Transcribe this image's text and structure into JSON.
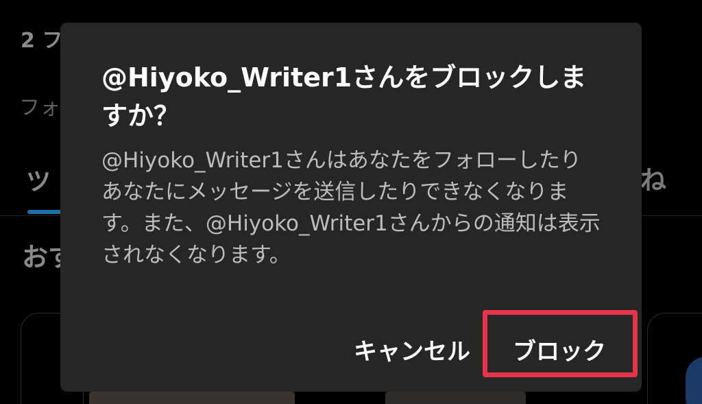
{
  "background": {
    "count_text": "2 フ",
    "follow_text": "フォ",
    "tab_left": "ツ",
    "tab_right": "ね",
    "section_title": "おす"
  },
  "dialog": {
    "title": "@Hiyoko_Writer1さんをブロックしますか？",
    "body": "@Hiyoko_Writer1さんはあなたをフォローしたりあなたにメッセージを送信したりできなくなります。また、@Hiyoko_Writer1さんからの通知は表示されなくなります。",
    "cancel_label": "キャンセル",
    "block_label": "ブロック"
  },
  "colors": {
    "dialog_background": "#262626",
    "highlight_border": "#e8344b",
    "tab_indicator": "#1d6fa8"
  }
}
